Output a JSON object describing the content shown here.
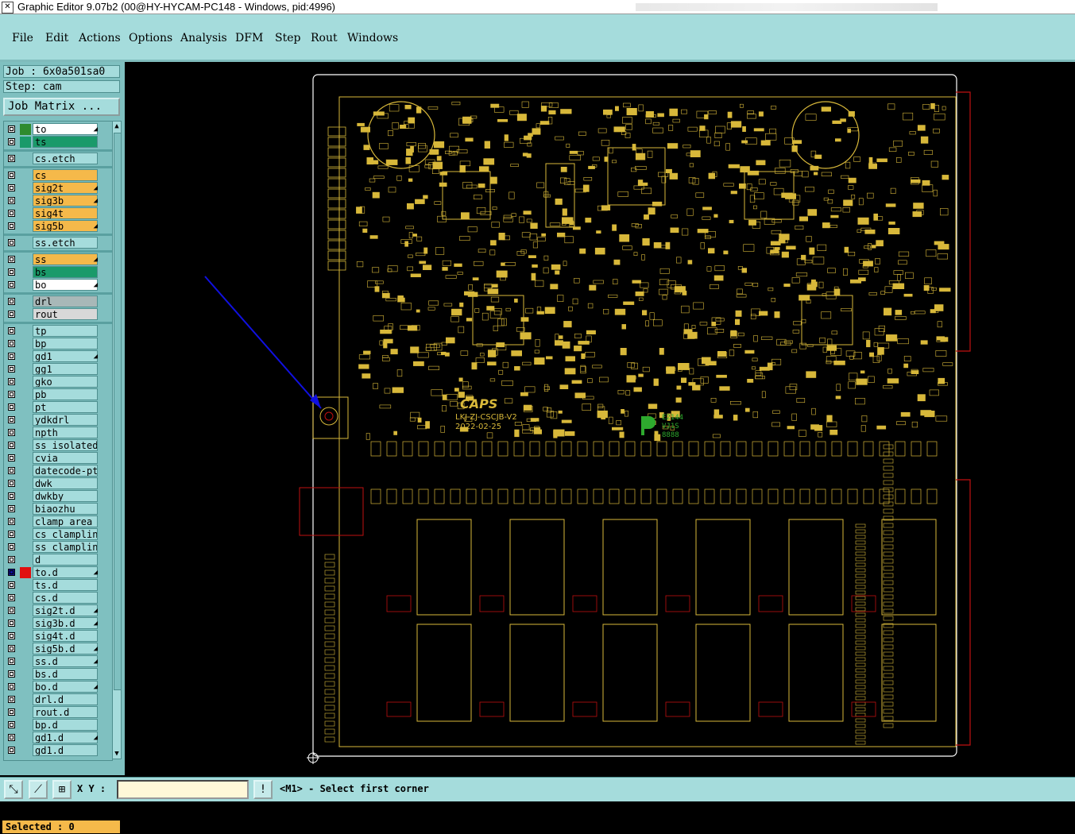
{
  "window": {
    "title": "Graphic Editor 9.07b2 (00@HY-HYCAM-PC148 - Windows, pid:4996)"
  },
  "menu": [
    "File",
    "Edit",
    "Actions",
    "Options",
    "Analysis",
    "DFM",
    "Step",
    "Rout",
    "Windows"
  ],
  "job": {
    "job_label": "Job  : 6x0a501sa0",
    "step_label": "Step: cam",
    "matrix_button": "Job Matrix ..."
  },
  "layers": [
    {
      "name": "to",
      "color": "#ffffff",
      "swatch": "#2e8b2e",
      "flag": true
    },
    {
      "name": "ts",
      "color": "#1a9a6a",
      "swatch": "#1a9a6a",
      "flag": false
    },
    {
      "name": "cs.etch",
      "color": "#a5dcdc",
      "swatch": "",
      "flag": false
    },
    {
      "name": "cs",
      "color": "#f5b94a",
      "swatch": "",
      "flag": false
    },
    {
      "name": "sig2t",
      "color": "#f5b94a",
      "swatch": "",
      "flag": true
    },
    {
      "name": "sig3b",
      "color": "#f5b94a",
      "swatch": "",
      "flag": true
    },
    {
      "name": "sig4t",
      "color": "#f5b94a",
      "swatch": "",
      "flag": false
    },
    {
      "name": "sig5b",
      "color": "#f5b94a",
      "swatch": "",
      "flag": true
    },
    {
      "name": "ss.etch",
      "color": "#a5dcdc",
      "swatch": "",
      "flag": false
    },
    {
      "name": "ss",
      "color": "#f5b94a",
      "swatch": "",
      "flag": true
    },
    {
      "name": "bs",
      "color": "#1a9a6a",
      "swatch": "",
      "flag": false
    },
    {
      "name": "bo",
      "color": "#ffffff",
      "swatch": "",
      "flag": true
    },
    {
      "name": "drl",
      "color": "#a8b8b8",
      "swatch": "",
      "flag": false
    },
    {
      "name": "rout",
      "color": "#d8d8d8",
      "swatch": "",
      "flag": false
    },
    {
      "name": "tp",
      "color": "#a5dcdc",
      "swatch": "",
      "flag": false
    },
    {
      "name": "bp",
      "color": "#a5dcdc",
      "swatch": "",
      "flag": false
    },
    {
      "name": "gd1",
      "color": "#a5dcdc",
      "swatch": "",
      "flag": true
    },
    {
      "name": "gg1",
      "color": "#a5dcdc",
      "swatch": "",
      "flag": false
    },
    {
      "name": "gko",
      "color": "#a5dcdc",
      "swatch": "",
      "flag": false
    },
    {
      "name": "pb",
      "color": "#a5dcdc",
      "swatch": "",
      "flag": false
    },
    {
      "name": "pt",
      "color": "#a5dcdc",
      "swatch": "",
      "flag": false
    },
    {
      "name": "ydkdrl",
      "color": "#a5dcdc",
      "swatch": "",
      "flag": false
    },
    {
      "name": "npth",
      "color": "#a5dcdc",
      "swatch": "",
      "flag": false
    },
    {
      "name": "ss_isolated_",
      "color": "#a5dcdc",
      "swatch": "",
      "flag": false
    },
    {
      "name": "cvia",
      "color": "#a5dcdc",
      "swatch": "",
      "flag": false
    },
    {
      "name": "datecode-ptc",
      "color": "#a5dcdc",
      "swatch": "",
      "flag": false
    },
    {
      "name": "dwk",
      "color": "#a5dcdc",
      "swatch": "",
      "flag": false
    },
    {
      "name": "dwkby",
      "color": "#a5dcdc",
      "swatch": "",
      "flag": false
    },
    {
      "name": "biaozhu",
      "color": "#a5dcdc",
      "swatch": "",
      "flag": false
    },
    {
      "name": "clamp_area",
      "color": "#a5dcdc",
      "swatch": "",
      "flag": false
    },
    {
      "name": "cs_clampline",
      "color": "#a5dcdc",
      "swatch": "",
      "flag": false
    },
    {
      "name": "ss_clampline",
      "color": "#a5dcdc",
      "swatch": "",
      "flag": false
    },
    {
      "name": "d",
      "color": "#a5dcdc",
      "swatch": "",
      "flag": false
    },
    {
      "name": "to.d",
      "color": "#a5dcdc",
      "swatch": "#e01010",
      "flag": true,
      "active": true
    },
    {
      "name": "ts.d",
      "color": "#a5dcdc",
      "swatch": "",
      "flag": false
    },
    {
      "name": "cs.d",
      "color": "#a5dcdc",
      "swatch": "",
      "flag": false
    },
    {
      "name": "sig2t.d",
      "color": "#a5dcdc",
      "swatch": "",
      "flag": true
    },
    {
      "name": "sig3b.d",
      "color": "#a5dcdc",
      "swatch": "",
      "flag": true
    },
    {
      "name": "sig4t.d",
      "color": "#a5dcdc",
      "swatch": "",
      "flag": false
    },
    {
      "name": "sig5b.d",
      "color": "#a5dcdc",
      "swatch": "",
      "flag": true
    },
    {
      "name": "ss.d",
      "color": "#a5dcdc",
      "swatch": "",
      "flag": true
    },
    {
      "name": "bs.d",
      "color": "#a5dcdc",
      "swatch": "",
      "flag": false
    },
    {
      "name": "bo.d",
      "color": "#a5dcdc",
      "swatch": "",
      "flag": true
    },
    {
      "name": "drl.d",
      "color": "#a5dcdc",
      "swatch": "",
      "flag": false
    },
    {
      "name": "rout.d",
      "color": "#a5dcdc",
      "swatch": "",
      "flag": false
    },
    {
      "name": "bp.d",
      "color": "#a5dcdc",
      "swatch": "",
      "flag": false
    },
    {
      "name": "gd1.d",
      "color": "#a5dcdc",
      "swatch": "",
      "flag": true
    },
    {
      "name": "gd1.d",
      "color": "#a5dcdc",
      "swatch": "",
      "flag": false
    }
  ],
  "status": {
    "selected": "Selected : 0",
    "xy_label": "X Y :",
    "xy_value": "",
    "message": "<M1> - Select first corner",
    "warn_icon": "!"
  },
  "board": {
    "silk_logo": "CAPS",
    "silk_part": "LKJ-ZJ-CSCJB-V2",
    "silk_date": "2022-02-25",
    "silk_code1": "E2144",
    "silk_code2": "VJ1S",
    "silk_code3": "8888",
    "color_board": "#d8b83a",
    "color_outline": "#ffffff",
    "color_arrow": "#1010e0",
    "color_rail": "#c01010"
  },
  "icons": [
    "app-icon",
    "zoom-box-icon",
    "measure-icon",
    "grid-icon",
    "snap-icon",
    "warning-icon"
  ]
}
